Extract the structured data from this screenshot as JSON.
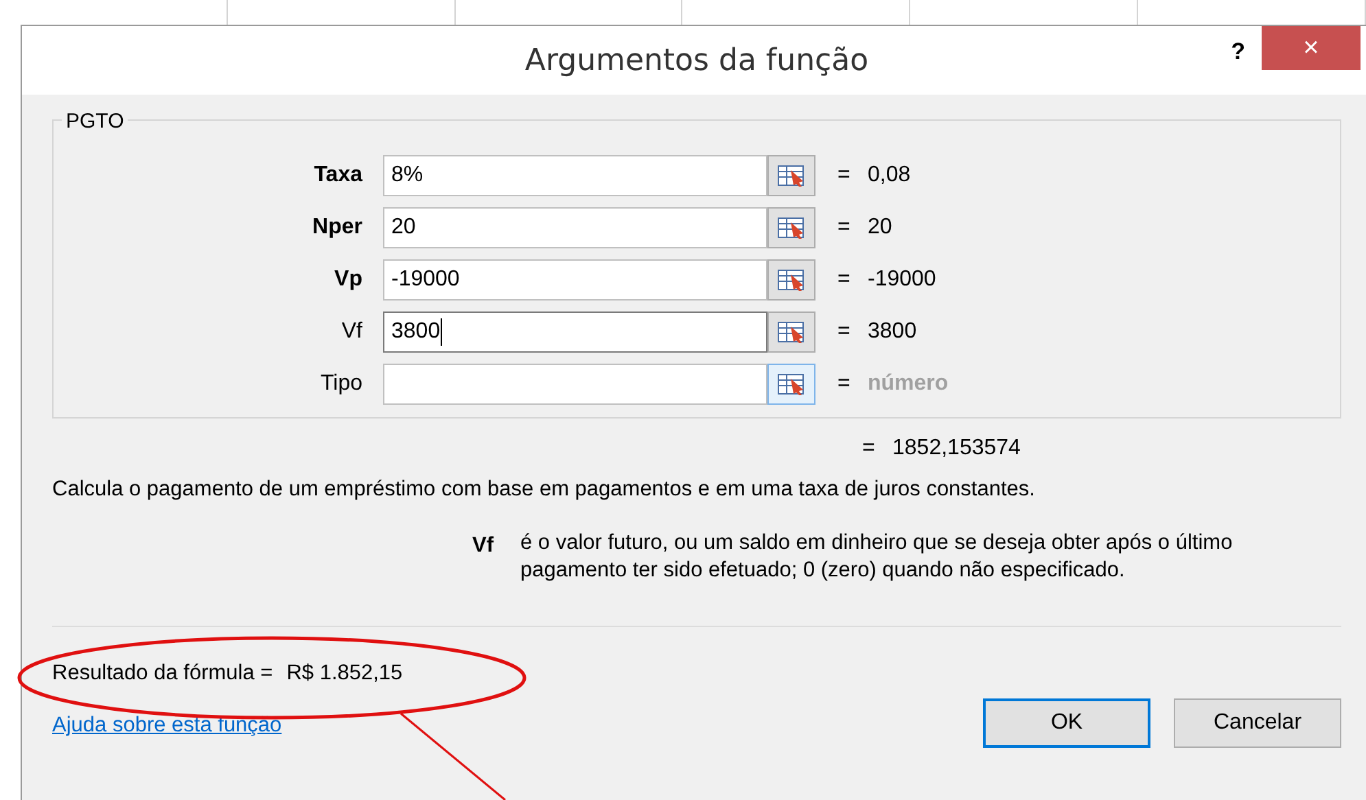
{
  "window": {
    "title": "Argumentos da função",
    "help": "?",
    "close": "×"
  },
  "group": {
    "title": "PGTO"
  },
  "arguments": [
    {
      "label": "Taxa",
      "required": true,
      "value": "8%",
      "focused": false,
      "result": "0,08",
      "muted": false
    },
    {
      "label": "Nper",
      "required": true,
      "value": "20",
      "focused": false,
      "result": "20",
      "muted": false
    },
    {
      "label": "Vp",
      "required": true,
      "value": "-19000",
      "focused": false,
      "result": "-19000",
      "muted": false
    },
    {
      "label": "Vf",
      "required": false,
      "value": "3800",
      "focused": true,
      "result": "3800",
      "muted": false
    },
    {
      "label": "Tipo",
      "required": false,
      "focused": false,
      "result": "número",
      "muted": true
    }
  ],
  "equals": "=",
  "function_result": "1852,153574",
  "description": "Calcula o pagamento de um empréstimo com base em pagamentos e em uma taxa de juros constantes.",
  "argument_help": {
    "name": "Vf",
    "text": "é o valor futuro, ou um saldo em dinheiro que se deseja obter após o último pagamento ter sido efetuado; 0 (zero) quando não especificado."
  },
  "formula_result": {
    "label": "Resultado da fórmula =",
    "value": "R$ 1.852,15"
  },
  "help_link": "Ajuda sobre esta função",
  "buttons": [
    {
      "label": "OK",
      "default": true
    },
    {
      "label": "Cancelar",
      "default": false
    }
  ]
}
